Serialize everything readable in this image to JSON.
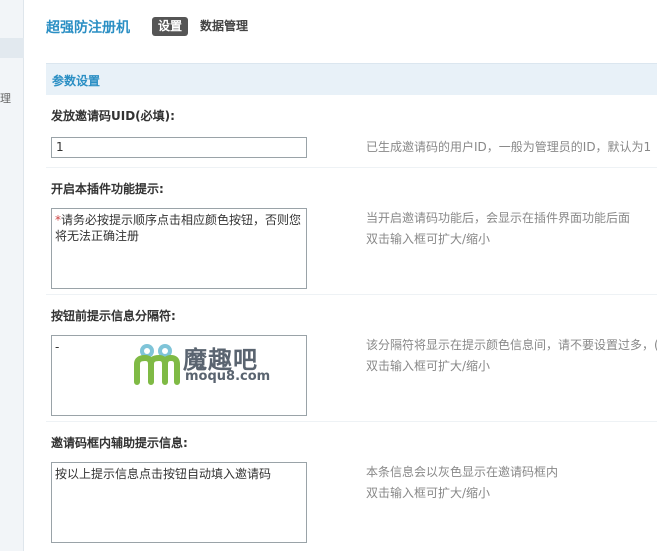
{
  "sidebar": {
    "fragment": "理"
  },
  "header": {
    "plugin_title": "超强防注册机",
    "tabs": [
      {
        "label": "设置",
        "active": true
      },
      {
        "label": "数据管理",
        "active": false
      }
    ]
  },
  "section": {
    "title": "参数设置"
  },
  "settings": [
    {
      "label": "发放邀请码UID(必填):",
      "value": "1",
      "help": "已生成邀请码的用户ID，一般为管理员的ID，默认为1"
    },
    {
      "label": "开启本插件功能提示:",
      "value_mark": "*",
      "value": "请务必按提示顺序点击相应颜色按钮，否则您将无法正确注册",
      "help": "当开启邀请码功能后，会显示在插件界面功能后面",
      "help2": "双击输入框可扩大/缩小"
    },
    {
      "label": "按钮前提示信息分隔符:",
      "value": "-",
      "help": "该分隔符将显示在提示颜色信息间，请不要设置过多，(",
      "help2": "双击输入框可扩大/缩小"
    },
    {
      "label": "邀请码框内辅助提示信息:",
      "value": "按以上提示信息点击按钮自动填入邀请码",
      "help": "本条信息会以灰色显示在邀请码框内",
      "help2": "双击输入框可扩大/缩小"
    }
  ],
  "watermark": {
    "title": "魔趣吧",
    "url": "moqu8.com"
  },
  "colors": {
    "accent": "#2b8fc4",
    "section_bg": "#e8f1f8",
    "tab_active_bg": "#555555"
  }
}
